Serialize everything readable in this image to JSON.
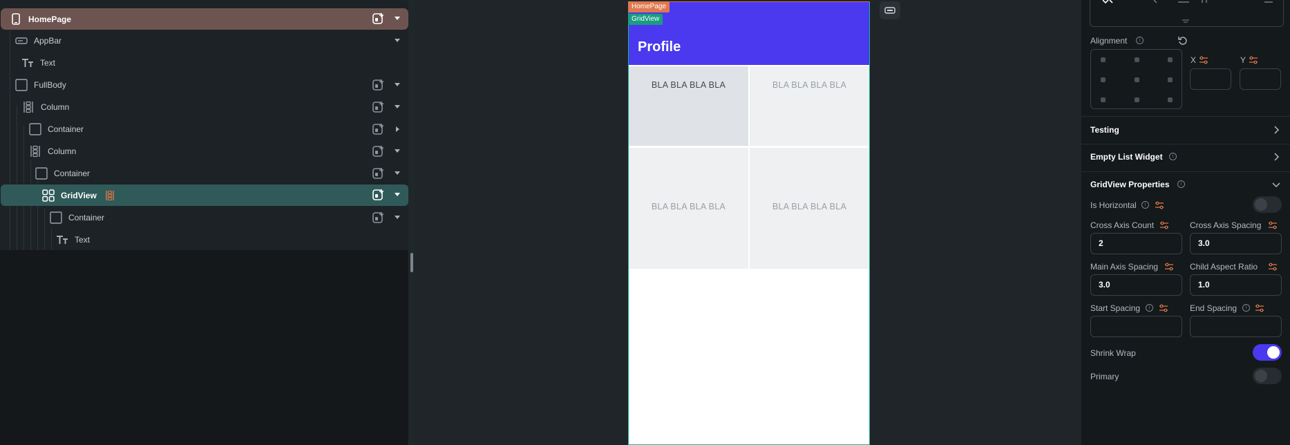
{
  "tree": {
    "rows": [
      {
        "label": "HomePage"
      },
      {
        "label": "AppBar"
      },
      {
        "label": "Text"
      },
      {
        "label": "FullBody"
      },
      {
        "label": "Column"
      },
      {
        "label": "Container"
      },
      {
        "label": "Column"
      },
      {
        "label": "Container"
      },
      {
        "label": "GridView"
      },
      {
        "label": "Container"
      },
      {
        "label": "Text"
      }
    ]
  },
  "canvas": {
    "tags": {
      "home": "HomePage",
      "grid": "GridView"
    },
    "appbar_title": "Profile",
    "cells": [
      "BLA BLA BLA BLA",
      "BLA BLA BLA BLA",
      "BLA BLA BLA BLA",
      "BLA BLA BLA BLA"
    ]
  },
  "props": {
    "alignment_label": "Alignment",
    "x_label": "X",
    "y_label": "Y",
    "x_value": "",
    "y_value": "",
    "testing_label": "Testing",
    "empty_list_label": "Empty List Widget",
    "gridview_props_label": "GridView Properties",
    "is_horizontal_label": "Is Horizontal",
    "is_horizontal": false,
    "cross_axis_count_label": "Cross Axis Count",
    "cross_axis_count": "2",
    "cross_axis_spacing_label": "Cross Axis Spacing",
    "cross_axis_spacing": "3.0",
    "main_axis_spacing_label": "Main Axis Spacing",
    "main_axis_spacing": "3.0",
    "child_aspect_ratio_label": "Child Aspect Ratio",
    "child_aspect_ratio": "1.0",
    "start_spacing_label": "Start Spacing",
    "start_spacing": "",
    "end_spacing_label": "End Spacing",
    "end_spacing": "",
    "shrink_wrap_label": "Shrink Wrap",
    "shrink_wrap": true,
    "primary_label": "Primary",
    "primary": false
  },
  "colors": {
    "accent": "#4a39ee",
    "homepage_row": "#6e5450",
    "gridview_row": "#2f5a59",
    "homepage_tag": "#e0784e",
    "gridview_tag": "#199c82",
    "option_icon": "#e07a45"
  },
  "icons": {
    "homepage": "phone-icon",
    "appbar": "appbar-icon",
    "text": "text-icon",
    "container": "container-icon",
    "column": "column-icon",
    "gridview": "grid-icon",
    "add": "add-widget-icon",
    "reset": "reset-icon",
    "info": "info-icon",
    "options": "options-icon",
    "chevron": "chevron-icon"
  }
}
